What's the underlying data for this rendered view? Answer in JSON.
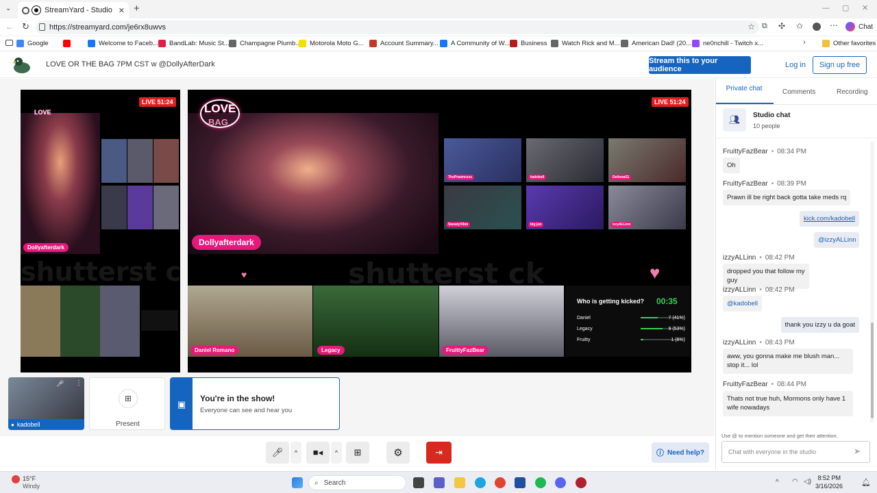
{
  "browser": {
    "tab_title": "StreamYard - Studio",
    "url": "https://streamyard.com/je6rx8uwvs",
    "chat_label": "Chat",
    "bookmarks": [
      {
        "label": "Google",
        "color": "#4285f4"
      },
      {
        "label": "",
        "color": "#ff0000"
      },
      {
        "label": "Welcome to Faceb...",
        "color": "#1877f2"
      },
      {
        "label": "BandLab: Music St...",
        "color": "#e11d48"
      },
      {
        "label": "Champagne Plumb...",
        "color": "#666666"
      },
      {
        "label": "Motorola Moto G...",
        "color": "#f5e100"
      },
      {
        "label": "Account Summary...",
        "color": "#c0392b"
      },
      {
        "label": "A Community of W...",
        "color": "#1877f2"
      },
      {
        "label": "Business",
        "color": "#b71c1c"
      },
      {
        "label": "Watch Rick and M...",
        "color": "#666666"
      },
      {
        "label": "American Dad! (20...",
        "color": "#666666"
      },
      {
        "label": "ne0nchill - Twitch x...",
        "color": "#9146ff"
      }
    ],
    "other_favorites": "Other favorites"
  },
  "app": {
    "studio_title": "LOVE OR THE BAG 7PM CST w @DollyAfterDark",
    "stream_button": "Stream this to your audience",
    "login": "Log in",
    "signup": "Sign up free"
  },
  "stage": {
    "live_badge": "LIVE 51:24",
    "watermark": "shutterst ck",
    "logo_line1": "LOVE",
    "logo_line2": "BAG",
    "host_name": "Dollyafterdark",
    "host_name_small": "Dollyafterdark",
    "guests": [
      "ThePrawncess",
      "kadobell",
      "DeltonaS1",
      "SweatyVibin",
      "big jon",
      "izzyALLinn"
    ],
    "bottom_guests": [
      "Daniel Romano",
      "Legacy",
      "FruittyFazBear"
    ],
    "poll": {
      "question": "Who is getting kicked?",
      "timer": "00:35",
      "options": [
        {
          "name": "Daniel",
          "result": "7 (41%)",
          "fraction": 0.41
        },
        {
          "name": "Legacy",
          "result": "9 (53%)",
          "fraction": 0.53
        },
        {
          "name": "Fruitty",
          "result": "1 (6%)",
          "fraction": 0.06
        }
      ]
    }
  },
  "tray": {
    "self_name": "kadobell",
    "present": "Present",
    "inshow_title": "You're in the show!",
    "inshow_sub": "Everyone can see and hear you",
    "help": "Need help?"
  },
  "sidebar": {
    "tabs": [
      "Private chat",
      "Comments",
      "Recording"
    ],
    "studio_chat": "Studio chat",
    "people": "10 people",
    "messages": [
      {
        "user": "FruittyFazBear",
        "time": "08:34 PM",
        "text": "Oh"
      },
      {
        "user": "FruittyFazBear",
        "time": "08:39 PM",
        "text": "Prawn ill be right back gotta take meds rq"
      },
      {
        "me": true,
        "text": "kick.com/kadobell"
      },
      {
        "me": true,
        "text": "@izzyALLinn"
      },
      {
        "user": "izzyALLinn",
        "time": "08:42 PM",
        "text": "dropped you that follow my guy"
      },
      {
        "user": "izzyALLinn",
        "time": "08:42 PM",
        "text": "@kadobell"
      },
      {
        "me": true,
        "text": "thank you izzy u da goat"
      },
      {
        "user": "izzyALLinn",
        "time": "08:43 PM",
        "text": "aww, you gonna make me blush man... stop it... lol"
      },
      {
        "user": "FruittyFazBear",
        "time": "08:44 PM",
        "text": "Thats not true huh, Mormons only have 1 wife nowadays"
      }
    ],
    "hint": "Use @ to mention someone and get their attention.",
    "input_placeholder": "Chat with everyone in the studio",
    "bullet": "•"
  },
  "taskbar": {
    "weather_temp": "15°F",
    "weather_desc": "Windy",
    "search": "Search",
    "time": "8:52 PM",
    "date": "3/16/2026"
  }
}
